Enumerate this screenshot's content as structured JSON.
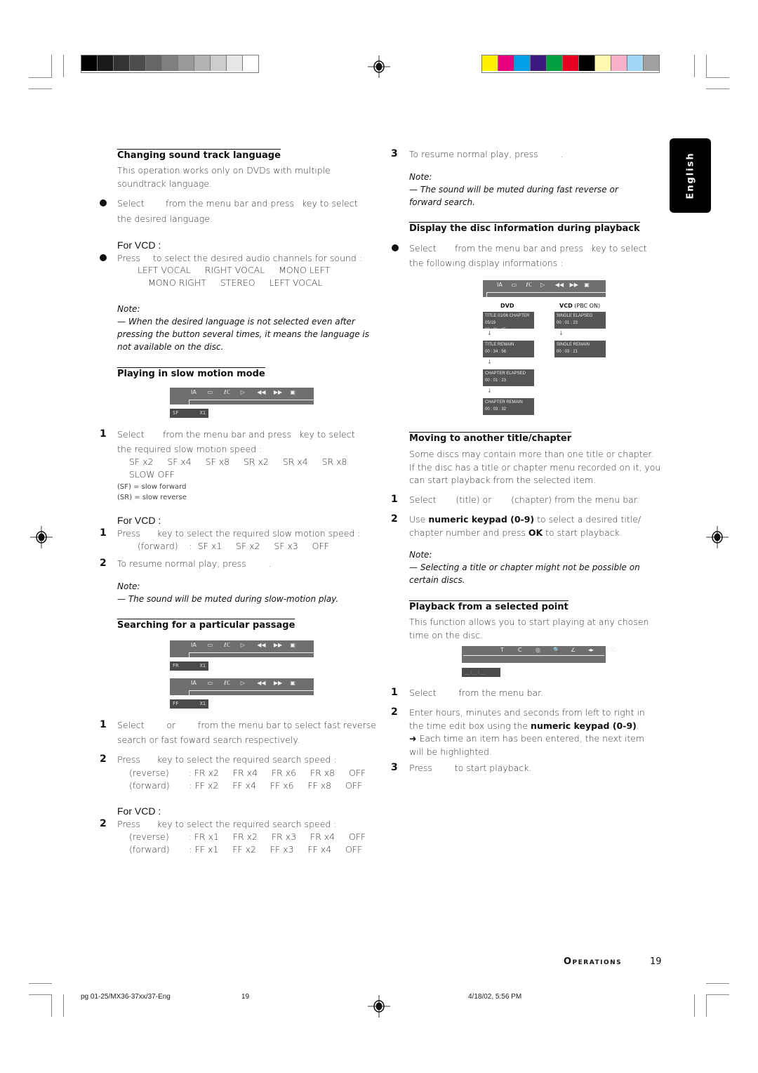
{
  "print_marks": {
    "grayscale_swatches": [
      "#000000",
      "#1a1a1a",
      "#333333",
      "#4d4d4d",
      "#666666",
      "#808080",
      "#999999",
      "#b3b3b3",
      "#cccccc",
      "#e6e6e6",
      "#ffffff"
    ],
    "color_swatches": [
      "#fff200",
      "#e6007e",
      "#00a0e9",
      "#3c1a7e",
      "#00a040",
      "#e60020",
      "#000000",
      "#fff9b0",
      "#f7b0c8",
      "#a0d8f5",
      "#a0a0a0"
    ]
  },
  "side_tab": {
    "label": "English"
  },
  "left": {
    "sound_track": {
      "heading": "Changing sound track language",
      "intro": "This operation works only on DVDs with multiple soundtrack language.",
      "bullet1_a": "Select",
      "bullet1_b": "from the menu bar and press",
      "bullet1_c": "key to select",
      "bullet1_d": "the desired language.",
      "for_vcd": "For VCD :",
      "vcd_press": "Press",
      "vcd_text": "to select the desired audio channels for sound :",
      "vcd_options_line1": "LEFT VOCAL     RIGHT VOCAL     MONO LEFT",
      "vcd_options_line2": "MONO RIGHT     STEREO     LEFT VOCAL",
      "note_label": "Note:",
      "note_text": "— When the desired language is not selected even after pressing the button several times, it means the language is not available on the disc."
    },
    "slow_motion": {
      "heading": "Playing in slow motion mode",
      "status_label": "SF",
      "status_value": "X1",
      "step1_num": "1",
      "step1_a": "Select",
      "step1_b": "from the menu bar and press",
      "step1_c": "key to select",
      "step1_d": "the required slow motion speed :",
      "speeds_line1": "SF x2     SF x4     SF x8     SR x2     SR x4     SR x8",
      "speeds_line2": "SLOW OFF",
      "legend_sf": "(SF) = slow forward",
      "legend_sr": "(SR) = slow reverse",
      "for_vcd": "For VCD :",
      "vcd_step1_num": "1",
      "vcd_step1": "Press      key to select the required slow motion speed :",
      "vcd_speeds": "(forward)    :  SF x1     SF x2     SF x3     OFF",
      "step2_num": "2",
      "step2": "To resume normal play, press        .",
      "note_label": "Note:",
      "note_text": "— The sound will be muted during slow-motion play."
    },
    "search": {
      "heading": "Searching for a particular passage",
      "status1_label": "FR",
      "status1_value": "X1",
      "status2_label": "FF",
      "status2_value": "X1",
      "step1_num": "1",
      "step1_a": "Select        or        from the menu bar to select fast reverse",
      "step1_b": "search or fast foward search respectively.",
      "step2_num": "2",
      "step2": "Press      key to select the required search speed :",
      "reverse_line": "(reverse)       : FR x2     FR x4     FR x6     FR x8     OFF",
      "forward_line": "(forward)       : FF x2     FF x4     FF x6     FF x8     OFF",
      "for_vcd": "For VCD :",
      "vcd_step2_num": "2",
      "vcd_step2": "Press      key to select the required search speed :",
      "vcd_reverse_line": "(reverse)       : FR x1     FR x2     FR x3     FR x4     OFF",
      "vcd_forward_line": "(forward)       : FF x1     FF x2     FF x3     FF x4     OFF"
    }
  },
  "right": {
    "resume": {
      "step3_num": "3",
      "step3": "To resume normal play, press        .",
      "note_label": "Note:",
      "note_text": "— The sound will be muted during fast reverse or forward search."
    },
    "disc_info": {
      "heading": "Display the disc information during playback",
      "bullet_a": "Select",
      "bullet_b": "from the menu bar and press",
      "bullet_c": "key to select",
      "bullet_d": "the following display informations :",
      "dvd_label": "DVD",
      "vcd_label": "VCD",
      "vcd_sub": "(PBC ON)",
      "dvd_boxes": [
        {
          "line1": "TITLE 01/06  CHAPTER 05/19",
          "line2": "00 : 36 : 15"
        },
        {
          "line1": "TITLE REMAIN",
          "line2": "00 : 34 : 56"
        },
        {
          "line1": "CHAPTER ELAPSED",
          "line2": "00 : 01 : 23"
        },
        {
          "line1": "CHAPTER REMAIN",
          "line2": "00 : 03 : 32"
        }
      ],
      "vcd_boxes": [
        {
          "line1": "SINGLE ELAPSED",
          "line2": "00 : 01 : 23"
        },
        {
          "line1": "SINGLE REMAIN",
          "line2": "00 : 03 : 21"
        }
      ]
    },
    "title_chapter": {
      "heading": "Moving to another title/chapter",
      "intro": "Some discs may contain more than one title or chapter. If the disc has a title or chapter menu recorded on it, you can start playback from the selected item.",
      "step1_num": "1",
      "step1": "Select       (title) or       (chapter) from the menu bar.",
      "step2_num": "2",
      "step2_a": "Use ",
      "step2_bold": "numeric keypad (0-9)",
      "step2_b": " to select a desired title/ chapter number and press ",
      "step2_ok": "OK",
      "step2_c": " to start playback.",
      "note_label": "Note:",
      "note_text": "— Selecting a title or chapter might not be possible on certain discs."
    },
    "selected_point": {
      "heading": "Playback from a selected point",
      "intro": "This function allows you to start playing at any chosen time on the disc.",
      "menu_items": [
        "T",
        "C",
        "◎",
        "🔍",
        "∠",
        "◂▸",
        "PBC"
      ],
      "time_box": "__:__:__",
      "step1_num": "1",
      "step1": "Select        from the menu bar.",
      "step2_num": "2",
      "step2_a": "Enter hours, minutes and seconds from left to right in the time edit box using the ",
      "step2_bold": "numeric keypad (0-9)",
      "step2_b": ".",
      "step2_arrow": "➜",
      "step2_result": " Each time an item has been entered, the next item will be highlighted.",
      "step3_num": "3",
      "step3": "Press        to start playback."
    }
  },
  "menu_bar_icons": [
    "ⅠA",
    "▭",
    "ℓℂ",
    "▷",
    "◀◀",
    "▶▶",
    "▣"
  ],
  "page_footer": {
    "section": "Operations",
    "page": "19"
  },
  "slug": {
    "file": "pg 01-25/MX36-37xx/37-Eng",
    "page": "19",
    "datetime": "4/18/02, 5:56 PM"
  }
}
